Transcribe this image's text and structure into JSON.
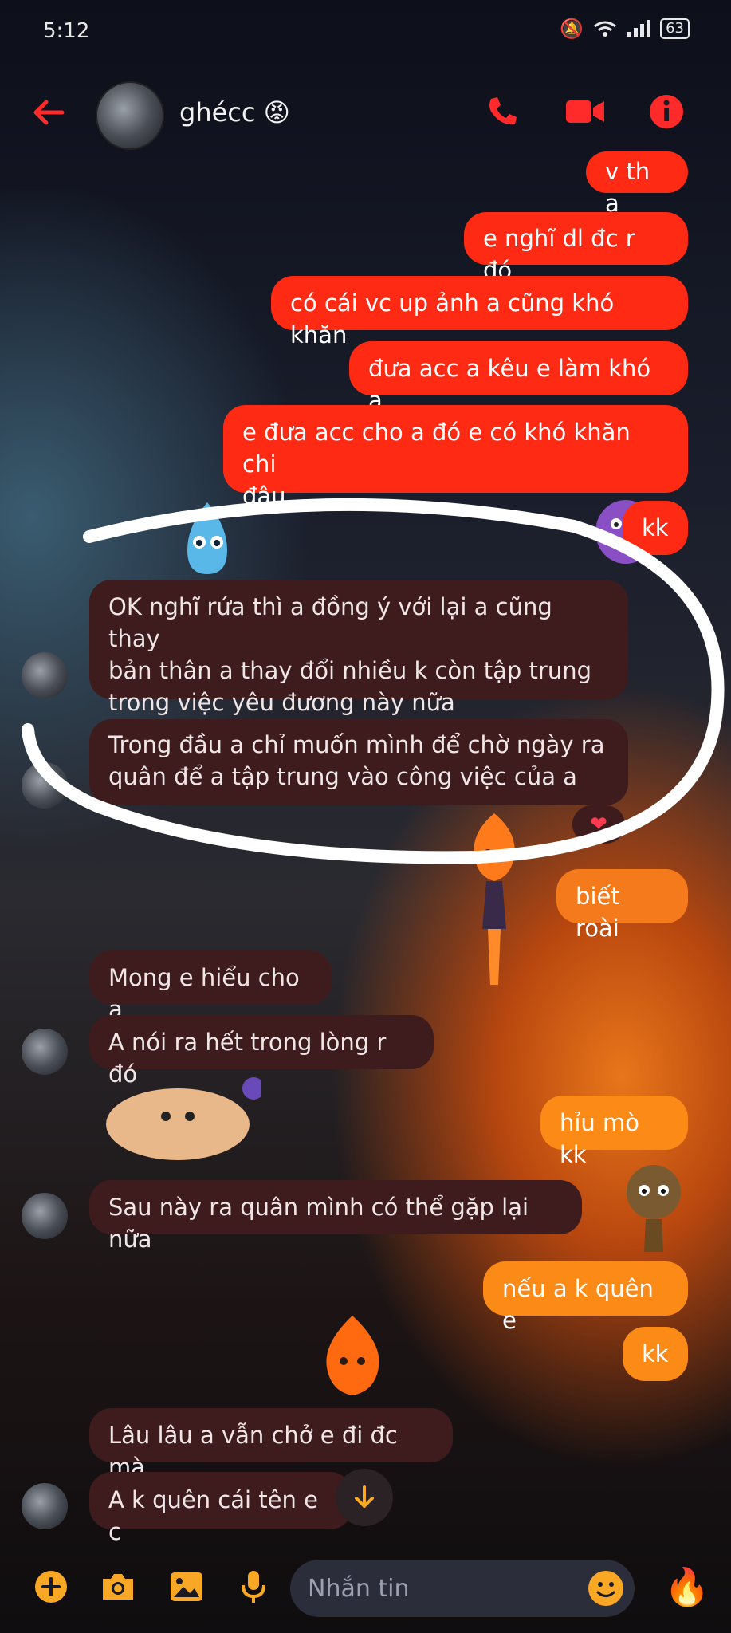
{
  "status_bar": {
    "time": "5:12",
    "battery": "63"
  },
  "header": {
    "contact_name": "ghécc",
    "name_emoji": "😡"
  },
  "messages": [
    {
      "text": "v th a"
    },
    {
      "text": "e nghĩ dl đc r đó"
    },
    {
      "text": "có cái vc up ảnh a cũng khó khăn"
    },
    {
      "text": "đưa acc a kêu e làm khó a"
    },
    {
      "line1": "e đưa acc cho a đó e có khó khăn chi",
      "line2": "đâu"
    },
    {
      "text": "kk"
    },
    {
      "line1": "OK nghĩ rứa thì a đồng ý với lại a cũng thay",
      "line2": "bản thân a thay đổi nhiều k còn tập trung",
      "line3": "trong việc yêu đương này nữa"
    },
    {
      "line1": "Trong đầu a chỉ muốn mình để chờ ngày ra",
      "line2": "quân để a tập trung vào công việc của a"
    },
    {
      "text": "biết roài"
    },
    {
      "text": "Mong e hiểu cho a"
    },
    {
      "text": "A nói ra hết trong lòng r đó"
    },
    {
      "text": "hỉu mò kk"
    },
    {
      "text": "Sau này ra quân mình có thể gặp lại nữa"
    },
    {
      "text": "nếu a k quên e"
    },
    {
      "text": "kk"
    },
    {
      "text": "Lâu lâu a vẫn chở e đi đc mà"
    },
    {
      "text": "A k quên cái tên e c"
    }
  ],
  "reaction": {
    "emoji": "❤"
  },
  "composer": {
    "placeholder": "Nhắn tin",
    "quick_reaction": "🔥"
  },
  "colors": {
    "accent": "#ff2a2a",
    "outgoing_red": "#ff2a14",
    "outgoing_orange": "#f47a1c",
    "incoming": "#3e1c1e",
    "composer_icons": "#f9a825"
  }
}
